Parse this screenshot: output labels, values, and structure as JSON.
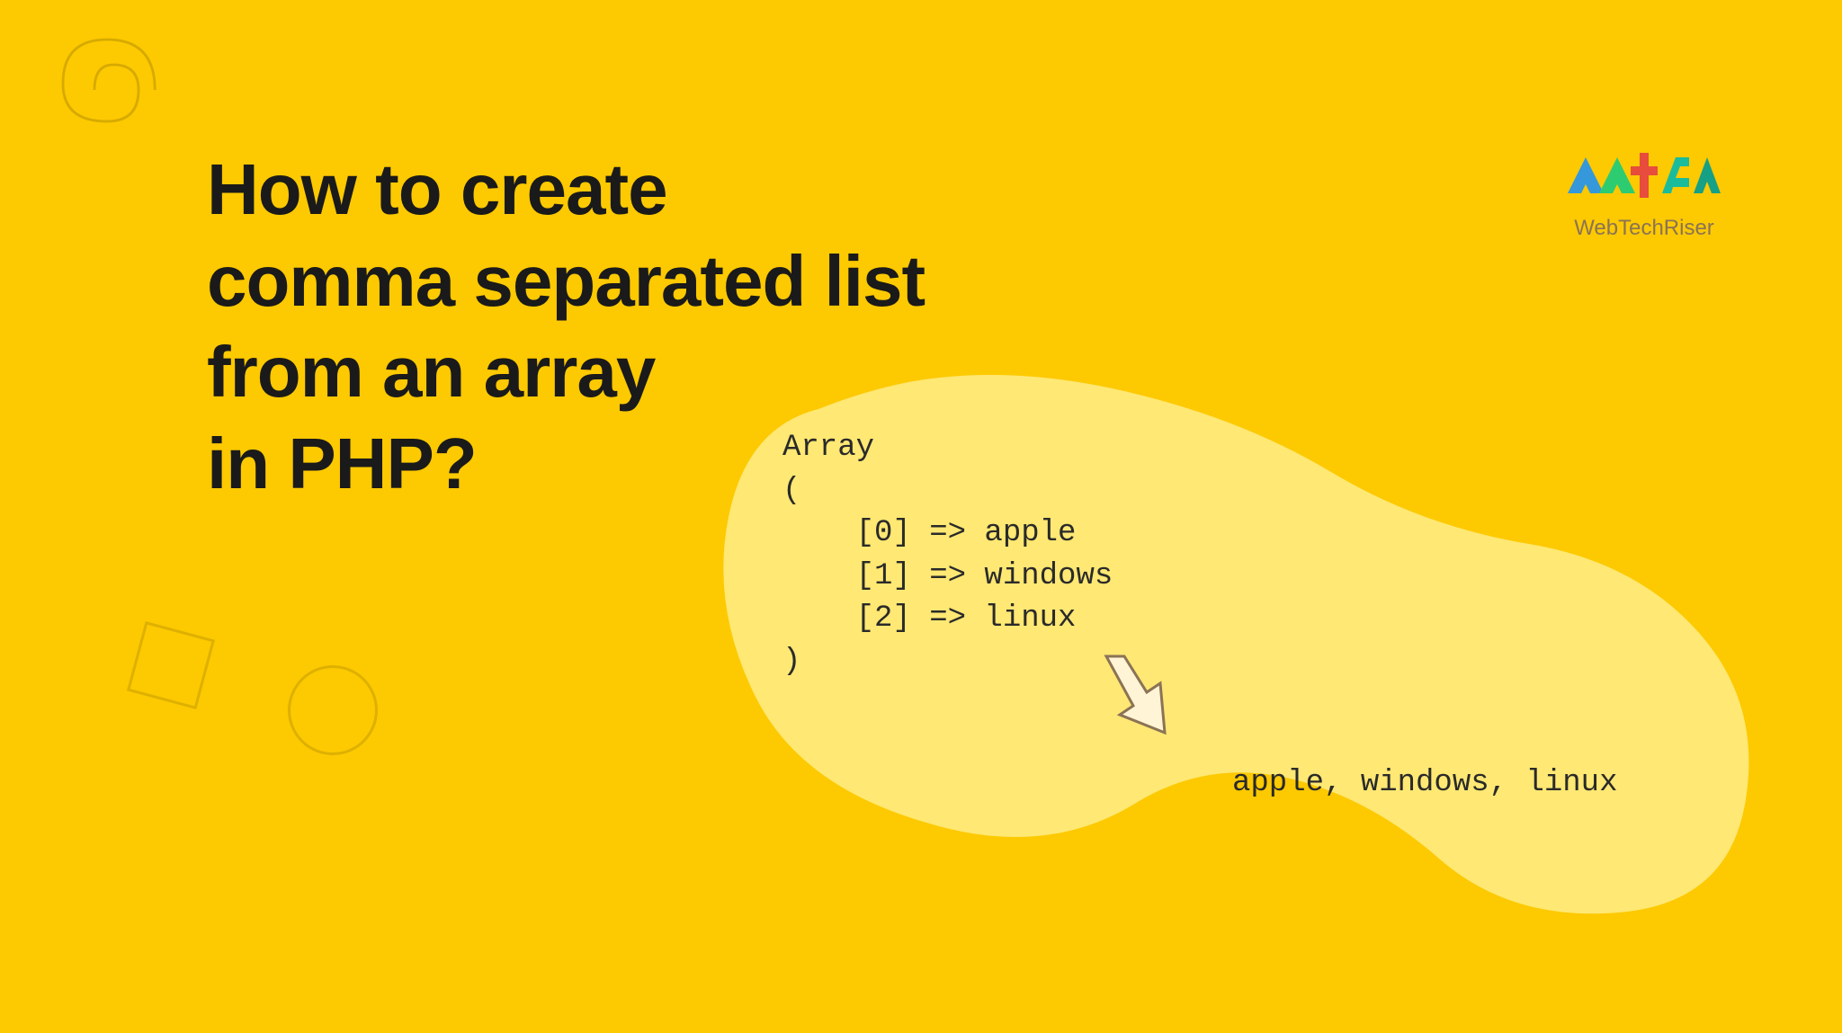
{
  "title": {
    "line1": "How to create",
    "line2": "comma separated list",
    "line3": "from an array",
    "line4": "in PHP?"
  },
  "logo": {
    "text": "WebTechRiser"
  },
  "code": {
    "line1": "Array",
    "line2": "(",
    "line3": "    [0] => apple",
    "line4": "    [1] => windows",
    "line5": "    [2] => linux",
    "line6": ")"
  },
  "result": "apple, windows, linux"
}
